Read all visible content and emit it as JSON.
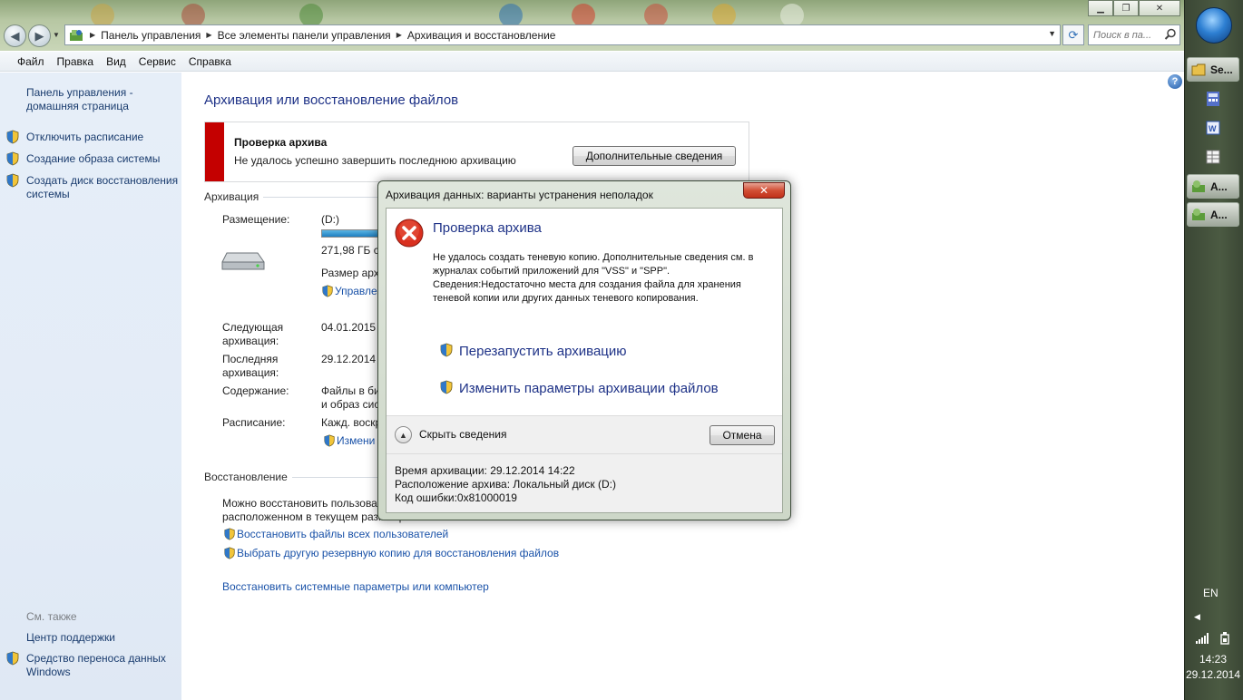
{
  "window": {
    "address": [
      "Панель управления",
      "Все элементы панели управления",
      "Архивация и восстановление"
    ],
    "search_placeholder": "Поиск в па...",
    "menu": [
      "Файл",
      "Правка",
      "Вид",
      "Сервис",
      "Справка"
    ]
  },
  "left_pane": {
    "home_link": "Панель управления - домашняя страница",
    "links": [
      "Отключить расписание",
      "Создание образа системы",
      "Создать диск восстановления системы"
    ],
    "see_also_title": "См. также",
    "see_also": [
      "Центр поддержки",
      "Средство переноса данных Windows"
    ]
  },
  "main": {
    "heading": "Архивация или восстановление файлов",
    "alert": {
      "title": "Проверка архива",
      "text": "Не удалось успешно завершить последнюю архивацию",
      "button": "Дополнительные сведения",
      "accent_color": "#c40000"
    },
    "backup_section": {
      "title": "Архивация",
      "location_label": "Размещение:",
      "location_value": "(D:)",
      "free_space": "271,98 ГБ св",
      "disk_fill_percent": 100,
      "backup_size": "Размер архи",
      "manage_link": "Управле",
      "next_label": "Следующая архивация:",
      "next_value": "04.01.2015 1",
      "last_label": "Последняя архивация:",
      "last_value": "29.12.2014 1",
      "contents_label": "Содержание:",
      "contents_value_1": "Файлы в би",
      "contents_value_2": "и образ сис",
      "schedule_label": "Расписание:",
      "schedule_value": "Кажд. воскр",
      "change_link": "Измени"
    },
    "restore_section": {
      "title": "Восстановление",
      "text_1": "Можно восстановить пользова",
      "text_2": "расположенном в текущем размещении.",
      "link_all_users": "Восстановить файлы всех пользователей",
      "link_other_backup": "Выбрать другую резервную копию для восстановления файлов",
      "link_system": "Восстановить системные параметры или компьютер"
    }
  },
  "dialog": {
    "title": "Архивация данных: варианты устранения неполадок",
    "heading": "Проверка архива",
    "message_1": "Не удалось создать теневую копию. Дополнительные сведения см. в журналах событий приложений для \"VSS\" и \"SPP\".",
    "message_2": "Сведения:Недостаточно места для создания файла для хранения теневой копии или других данных теневого копирования.",
    "action_restart": "Перезапустить архивацию",
    "action_change": "Изменить параметры архивации файлов",
    "hide_details": "Скрыть сведения",
    "cancel": "Отмена",
    "details": [
      "Время архивации: 29.12.2014 14:22",
      "Расположение архива: Локальный диск (D:)",
      "Код ошибки:0x81000019"
    ]
  },
  "taskbar": {
    "items": [
      "Se...",
      "A...",
      "A..."
    ],
    "language": "EN",
    "time": "14:23",
    "date": "29.12.2014"
  }
}
